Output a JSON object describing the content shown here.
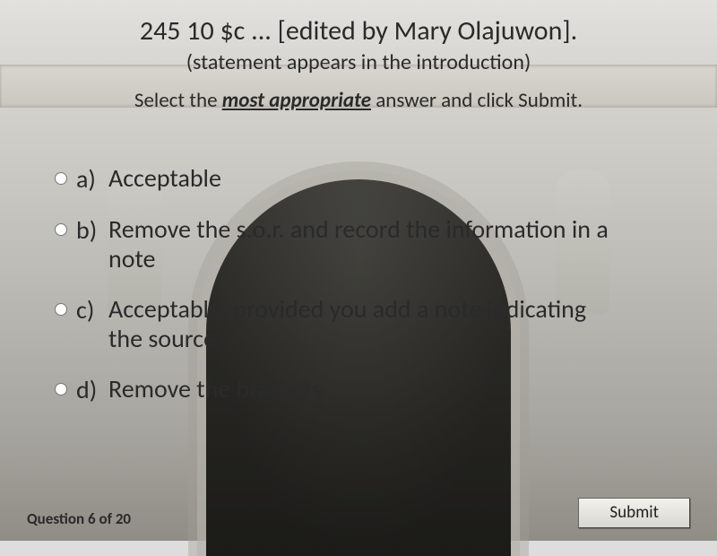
{
  "question": {
    "heading": "245 10 $c ... [edited by Mary Olajuwon].",
    "subheading": "(statement appears in the introduction)",
    "instruction_pre": "Select the ",
    "instruction_emph": "most appropriate",
    "instruction_post": " answer and click Submit."
  },
  "options": [
    {
      "letter": "a)",
      "text": "Acceptable"
    },
    {
      "letter": "b)",
      "text": "Remove the s.o.r. and record the information in a note"
    },
    {
      "letter": "c)",
      "text": "Acceptable, provided you add a note indicating the source"
    },
    {
      "letter": "d)",
      "text": "Remove the brackets"
    }
  ],
  "progress": "Question 6 of 20",
  "submit_label": "Submit"
}
